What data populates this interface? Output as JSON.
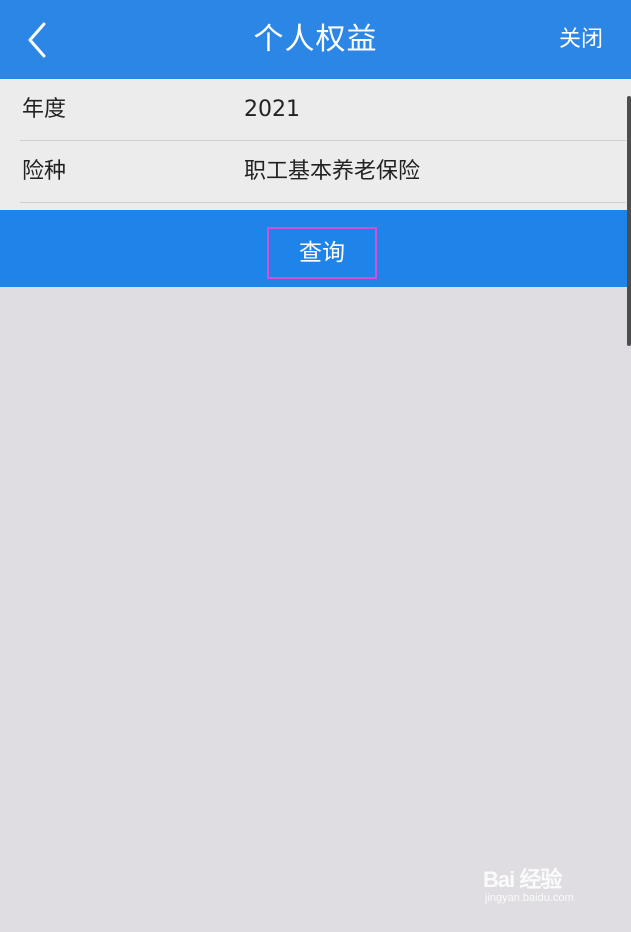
{
  "header": {
    "title": "个人权益",
    "close_label": "关闭",
    "back_icon": "chevron-left-icon",
    "background_color": "#2c86e6"
  },
  "form": {
    "rows": [
      {
        "label": "年度",
        "value": "2021"
      },
      {
        "label": "险种",
        "value": "职工基本养老保险"
      }
    ]
  },
  "query": {
    "label": "查询",
    "bar_color": "#1e84ea",
    "highlight_color": "#d54fd6"
  },
  "watermark": {
    "brand": "Bai 经验",
    "url": "jingyan.baidu.com"
  }
}
